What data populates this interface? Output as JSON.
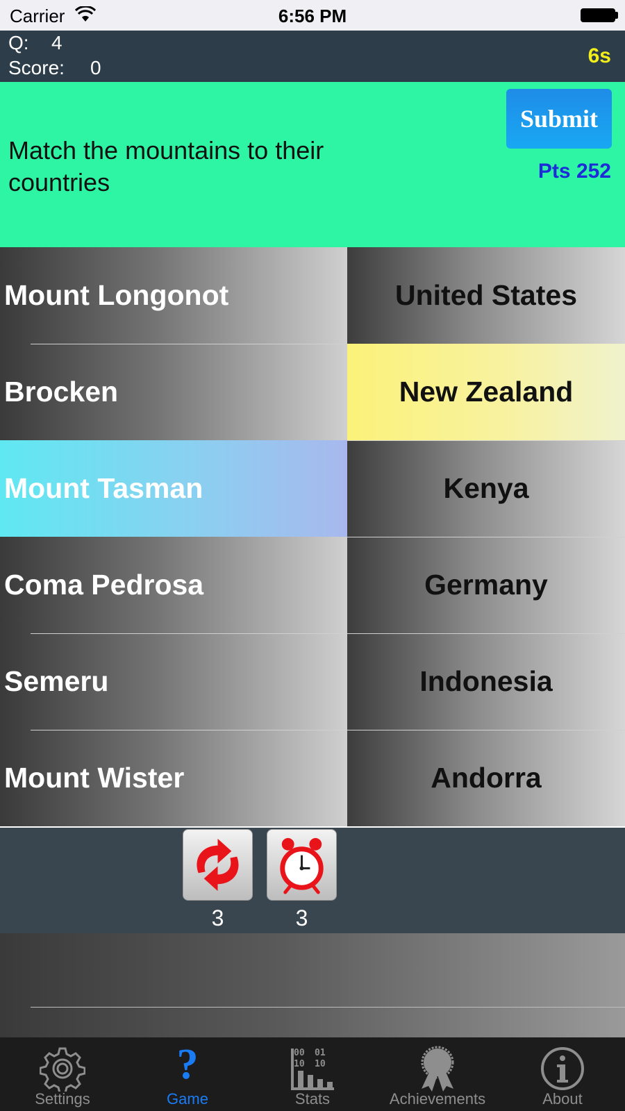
{
  "status_bar": {
    "carrier": "Carrier",
    "time": "6:56 PM"
  },
  "header": {
    "q_label": "Q:",
    "q_value": "4",
    "score_label": "Score:",
    "score_value": "0",
    "timer": "6s"
  },
  "question": {
    "text": "Match the mountains to their countries",
    "submit_label": "Submit",
    "points": "Pts 252"
  },
  "left_items": [
    "Mount Longonot",
    "Brocken",
    "Mount Tasman",
    "Coma Pedrosa",
    "Semeru",
    "Mount Wister"
  ],
  "right_items": [
    "United States",
    "New Zealand",
    "Kenya",
    "Germany",
    "Indonesia",
    "Andorra"
  ],
  "selected": {
    "left_index": 2,
    "right_index": 1
  },
  "powerups": [
    {
      "icon": "refresh-icon",
      "count": "3"
    },
    {
      "icon": "alarm-clock-icon",
      "count": "3"
    }
  ],
  "tabs": [
    {
      "label": "Settings",
      "icon": "gear-icon",
      "active": false
    },
    {
      "label": "Game",
      "icon": "question-mark-icon",
      "active": true
    },
    {
      "label": "Stats",
      "icon": "stats-icon",
      "active": false
    },
    {
      "label": "Achievements",
      "icon": "ribbon-icon",
      "active": false
    },
    {
      "label": "About",
      "icon": "info-icon",
      "active": false
    }
  ],
  "colors": {
    "question_bg": "#2ef5a3",
    "selected_left": "#5fe8f2",
    "selected_right": "#fbf27a",
    "timer": "#f2ee1a",
    "points": "#1d2bd8",
    "active_tab": "#1a7cf5"
  }
}
